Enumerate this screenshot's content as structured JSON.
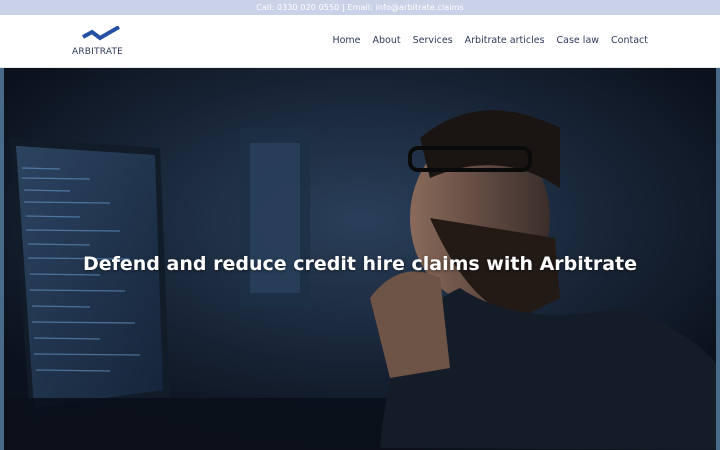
{
  "topbar": {
    "contact_text": "Call: 0330 020 0550 | Email: info@arbitrate.claims"
  },
  "brand": {
    "name": "ARBITRATE",
    "logo_icon": "zigzag-check-icon",
    "color": "#2451a6"
  },
  "nav": {
    "items": [
      {
        "label": "Home"
      },
      {
        "label": "About"
      },
      {
        "label": "Services"
      },
      {
        "label": "Arbitrate articles"
      },
      {
        "label": "Case law"
      },
      {
        "label": "Contact"
      }
    ]
  },
  "hero": {
    "heading": "Defend and reduce credit hire claims with Arbitrate"
  },
  "colors": {
    "topbar_bg": "#c9d2e6",
    "nav_text": "#2f3b59",
    "hero_bg": "#0e1624"
  }
}
